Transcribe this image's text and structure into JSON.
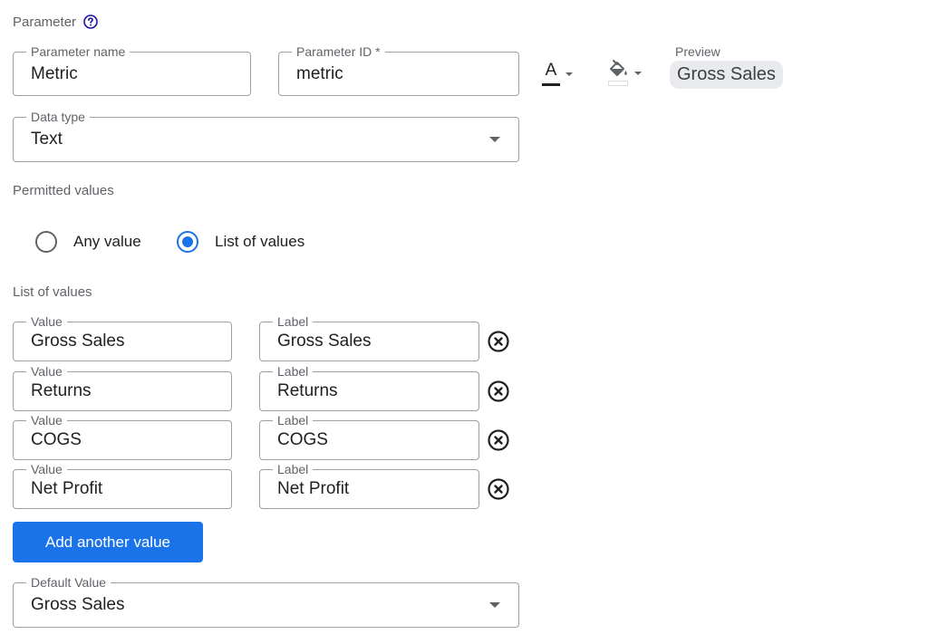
{
  "header": {
    "title": "Parameter"
  },
  "fields": {
    "parameter_name": {
      "label": "Parameter name",
      "value": "Metric"
    },
    "parameter_id": {
      "label": "Parameter ID *",
      "value": "metric"
    },
    "data_type": {
      "label": "Data type",
      "value": "Text"
    }
  },
  "toolbar": {
    "text_color_letter": "A",
    "text_color": "#202124",
    "fill_color": "#ffffff"
  },
  "preview": {
    "label": "Preview",
    "value": "Gross Sales"
  },
  "permitted_values": {
    "label": "Permitted values",
    "options": [
      {
        "label": "Any value",
        "checked": false
      },
      {
        "label": "List of values",
        "checked": true
      }
    ]
  },
  "list_of_values": {
    "label": "List of values",
    "value_label": "Value",
    "label_label": "Label",
    "rows": [
      {
        "value": "Gross Sales",
        "label": "Gross Sales"
      },
      {
        "value": "Returns",
        "label": "Returns"
      },
      {
        "value": "COGS",
        "label": "COGS"
      },
      {
        "value": "Net Profit",
        "label": "Net Profit"
      }
    ],
    "add_button": "Add another value"
  },
  "default_value": {
    "label": "Default Value",
    "value": "Gross Sales"
  },
  "colors": {
    "accent": "#1a73e8",
    "border": "#9aa0a6",
    "muted_text": "#5f6368"
  }
}
